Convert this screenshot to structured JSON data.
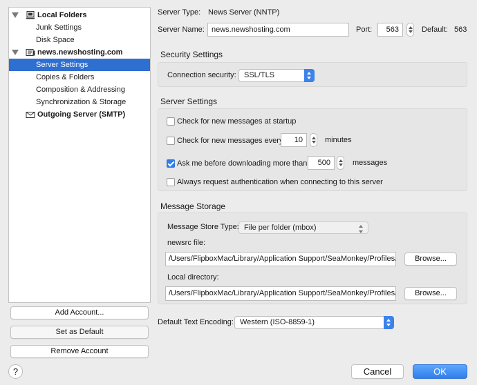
{
  "tree": {
    "local_folders": "Local Folders",
    "junk_settings": "Junk Settings",
    "disk_space": "Disk Space",
    "account": "news.newshosting.com",
    "server_settings": "Server Settings",
    "copies_folders": "Copies & Folders",
    "composition": "Composition & Addressing",
    "sync_storage": "Synchronization & Storage",
    "outgoing": "Outgoing Server (SMTP)"
  },
  "left_buttons": {
    "add_account": "Add Account...",
    "set_default": "Set as Default",
    "remove_account": "Remove Account"
  },
  "server": {
    "type_label": "Server Type:",
    "type_value": "News Server (NNTP)",
    "name_label": "Server Name:",
    "name_value": "news.newshosting.com",
    "port_label": "Port:",
    "port_value": "563",
    "default_label": "Default:",
    "default_value": "563"
  },
  "security": {
    "title": "Security Settings",
    "conn_label": "Connection security:",
    "conn_value": "SSL/TLS"
  },
  "server_settings": {
    "title": "Server Settings",
    "check_startup": "Check for new messages at startup",
    "check_every": "Check for new messages every",
    "every_value": "10",
    "minutes": "minutes",
    "ask_before": "Ask me before downloading more than",
    "ask_value": "500",
    "messages": "messages",
    "always_auth": "Always request authentication when connecting to this server"
  },
  "storage": {
    "title": "Message Storage",
    "store_type_label": "Message Store Type:",
    "store_type_value": "File per folder (mbox)",
    "newsrc_label": "newsrc file:",
    "newsrc_value": "/Users/FlipboxMac/Library/Application Support/SeaMonkey/Profiles/o",
    "browse1": "Browse...",
    "localdir_label": "Local directory:",
    "localdir_value": "/Users/FlipboxMac/Library/Application Support/SeaMonkey/Profiles/o",
    "browse2": "Browse..."
  },
  "encoding": {
    "label": "Default Text Encoding:",
    "value": "Western (ISO-8859-1)"
  },
  "footer": {
    "help": "?",
    "cancel": "Cancel",
    "ok": "OK"
  },
  "colors": {
    "selection": "#2e6fd0",
    "accent": "#3b82ea"
  }
}
